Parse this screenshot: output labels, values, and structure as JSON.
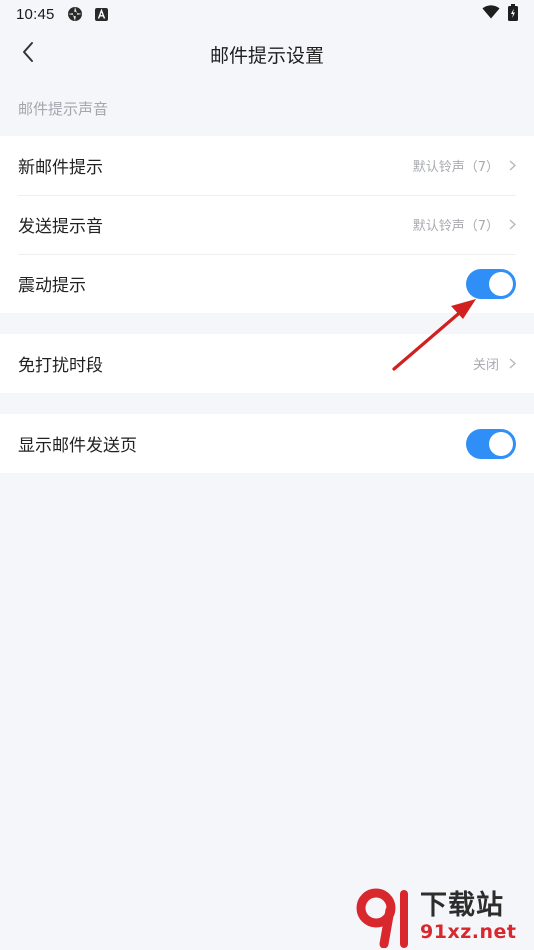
{
  "status_bar": {
    "time": "10:45",
    "icons": [
      "aperture-icon",
      "a-badge-icon",
      "wifi-icon",
      "battery-icon"
    ]
  },
  "nav": {
    "title": "邮件提示设置",
    "back_icon": "chevron-left-icon"
  },
  "section": {
    "header": "邮件提示声音"
  },
  "group1": {
    "new_mail": {
      "label": "新邮件提示",
      "value": "默认铃声（7）"
    },
    "send_sound": {
      "label": "发送提示音",
      "value": "默认铃声（7）"
    },
    "vibrate": {
      "label": "震动提示",
      "enabled": true
    }
  },
  "group2": {
    "dnd": {
      "label": "免打扰时段",
      "value": "关闭"
    }
  },
  "group3": {
    "show_send_page": {
      "label": "显示邮件发送页",
      "enabled": true
    }
  },
  "colors": {
    "accent": "#2f8ff6",
    "background": "#f5f6fa",
    "annotation_arrow": "#d21f1f"
  },
  "watermark": {
    "brand_cn": "下载站",
    "brand_en": "91xz.net"
  }
}
